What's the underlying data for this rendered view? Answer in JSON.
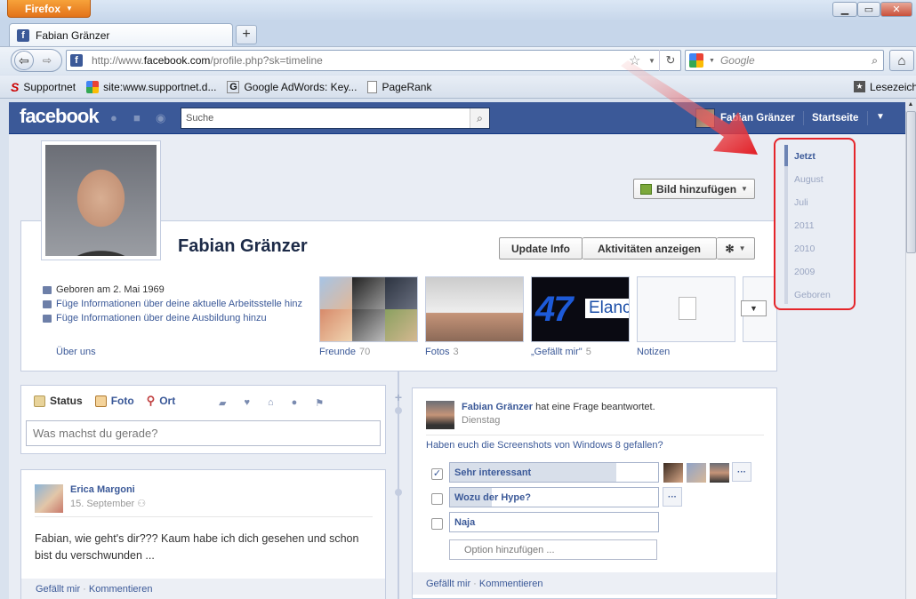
{
  "browser": {
    "menu_button": "Firefox",
    "tab_title": "Fabian Gränzer",
    "url_prefix": "http://www.",
    "url_domain": "facebook.com",
    "url_path": "/profile.php?sk=timeline",
    "search_placeholder": "Google",
    "bookmarks": [
      {
        "label": "Supportnet"
      },
      {
        "label": "site:www.supportnet.d..."
      },
      {
        "label": "Google AdWords: Key..."
      },
      {
        "label": "PageRank"
      }
    ],
    "bookmarks_right": "Lesezeichen"
  },
  "fb": {
    "logo": "facebook",
    "search_placeholder": "Suche",
    "user_name": "Fabian Gränzer",
    "home": "Startseite"
  },
  "profile": {
    "name": "Fabian Gränzer",
    "add_picture": "Bild hinzufügen",
    "update_info": "Update Info",
    "show_activity": "Aktivitäten anzeigen",
    "info": [
      "Geboren am 2. Mai 1969",
      "Füge Informationen über deine aktuelle Arbeitsstelle hinzu",
      "Füge Informationen über deine Ausbildung hinzu"
    ],
    "about": "Über uns",
    "tiles": [
      {
        "label": "Freunde",
        "count": "70"
      },
      {
        "label": "Fotos",
        "count": "3"
      },
      {
        "label": "„Gefällt mir\"",
        "count": "5"
      },
      {
        "label": "Notizen",
        "count": ""
      }
    ],
    "like_tile_text": "47",
    "like_tile_brand": "Elance"
  },
  "composer": {
    "tabs": [
      "Status",
      "Foto",
      "Ort"
    ],
    "placeholder": "Was machst du gerade?"
  },
  "post1": {
    "author": "Erica Margoni",
    "date": "15. September",
    "text": "Fabian, wie geht's dir??? Kaum habe ich dich gesehen und schon bist du verschwunden ...",
    "like": "Gefällt mir",
    "sep": " · ",
    "comment": "Kommentieren"
  },
  "post2": {
    "author": "Fabian Gränzer",
    "action": " hat eine Frage beantwortet.",
    "date": "Dienstag",
    "question": "Haben euch die Screenshots von Windows 8 gefallen?",
    "options": [
      {
        "label": "Sehr interessant",
        "checked": true,
        "fill": 0.8
      },
      {
        "label": "Wozu der Hype?",
        "checked": false,
        "fill": 0.2
      },
      {
        "label": "Naja",
        "checked": false,
        "fill": 0
      }
    ],
    "more": "···",
    "add_option": "Option hinzufügen ...",
    "like": "Gefällt mir",
    "sep": " · ",
    "comment": "Kommentieren"
  },
  "timeline_nav": [
    "Jetzt",
    "August",
    "Juli",
    "2011",
    "2010",
    "2009",
    "Geboren"
  ],
  "colors": {
    "fb_blue": "#3b5998",
    "highlight_red": "#e5252a"
  }
}
